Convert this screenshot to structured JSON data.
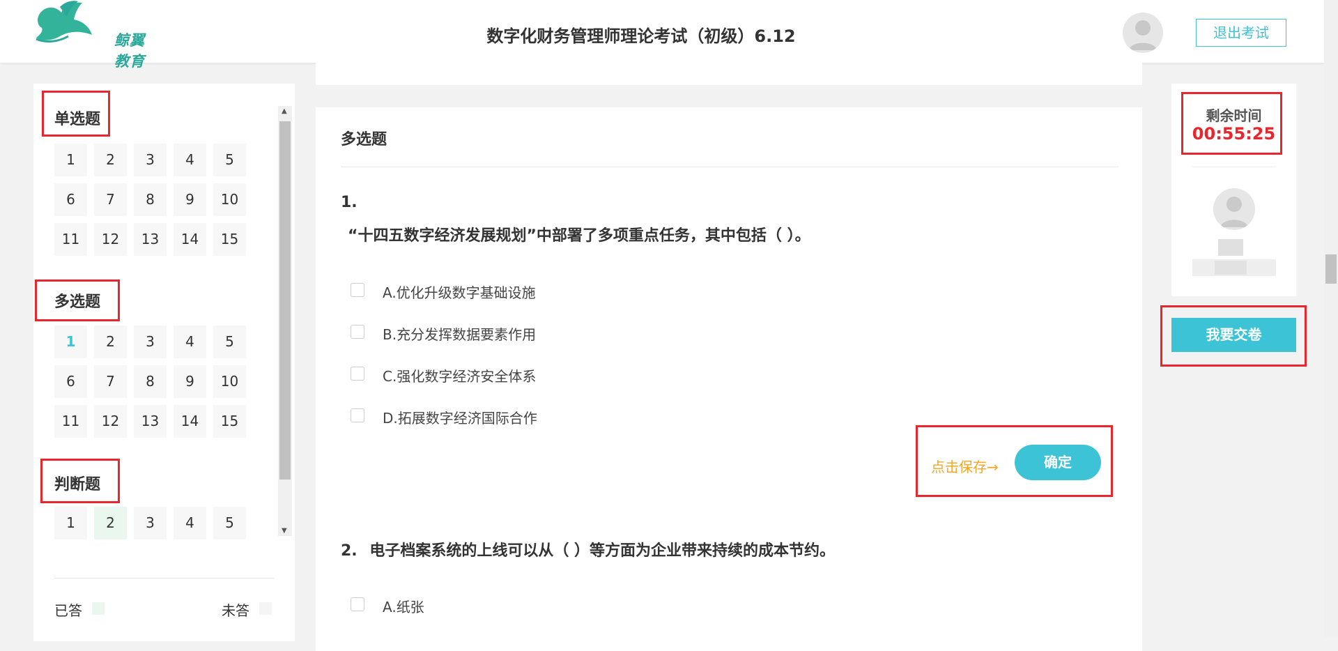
{
  "header": {
    "logo_text": "鲸翼教育",
    "exam_title": "数字化财务管理师理论考试（初级）6.12",
    "exit_label": "退出考试"
  },
  "sidebar": {
    "sections": [
      {
        "title": "单选题",
        "numbers": [
          "1",
          "2",
          "3",
          "4",
          "5",
          "6",
          "7",
          "8",
          "9",
          "10",
          "11",
          "12",
          "13",
          "14",
          "15"
        ]
      },
      {
        "title": "多选题",
        "numbers": [
          "1",
          "2",
          "3",
          "4",
          "5",
          "6",
          "7",
          "8",
          "9",
          "10",
          "11",
          "12",
          "13",
          "14",
          "15"
        ],
        "current": "1"
      },
      {
        "title": "判断题",
        "numbers": [
          "1",
          "2",
          "3",
          "4",
          "5"
        ],
        "answered": [
          "2"
        ]
      }
    ],
    "legend_answered": "已答",
    "legend_unanswered": "未答"
  },
  "main": {
    "section_title": "多选题",
    "q1": {
      "number": "1.",
      "stem": "“十四五数字经济发展规划”中部署了多项重点任务，其中包括（   ）。",
      "options": [
        "A.优化升级数字基础设施",
        "B.充分发挥数据要素作用",
        "C.强化数字经济安全体系",
        "D.拓展数字经济国际合作"
      ]
    },
    "save_hint": "点击保存→",
    "confirm_label": "确定",
    "q2": {
      "number": "2.",
      "stem": "电子档案系统的上线可以从（ ）等方面为企业带来持续的成本节约。",
      "options": [
        "A.纸张"
      ]
    }
  },
  "right": {
    "timer_label": "剩余时间",
    "timer_value": "00:55:25",
    "submit_label": "我要交卷"
  },
  "colors": {
    "accent": "#3cc3d6",
    "highlight_red": "#e8262e",
    "save_hint": "#f5a623",
    "answered_bg": "#eaf7ee"
  }
}
